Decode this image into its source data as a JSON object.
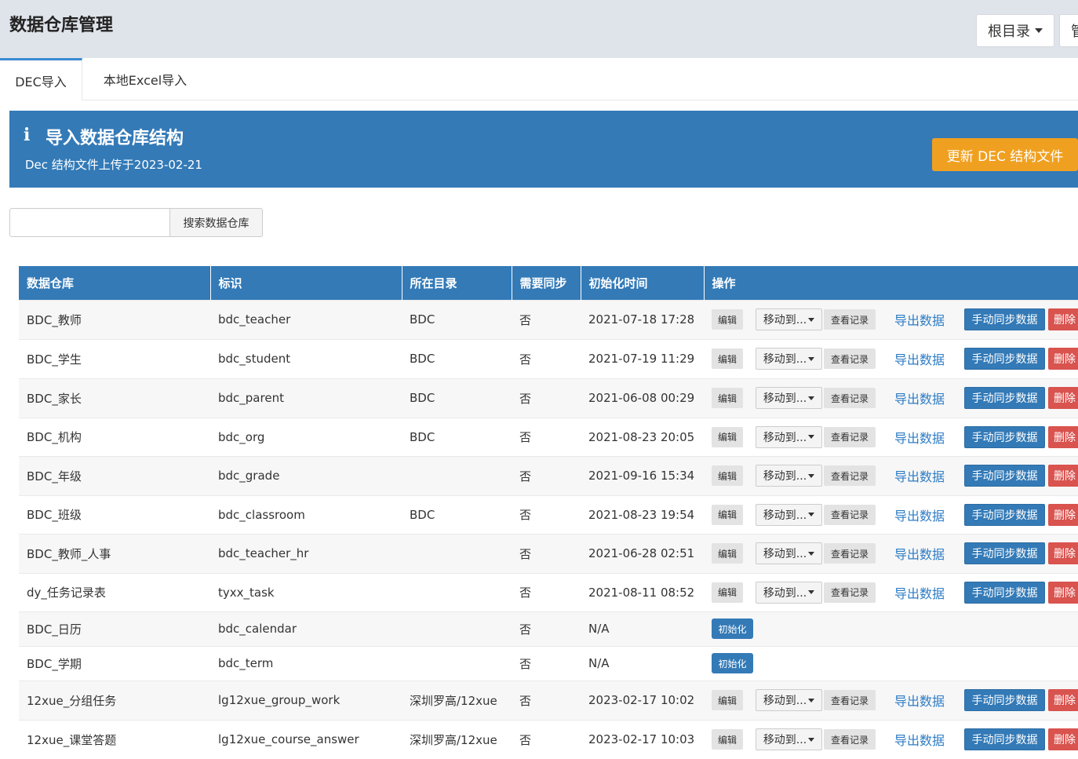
{
  "header": {
    "title": "数据仓库管理",
    "root_dir_label": "根目录",
    "manage_label": "管"
  },
  "tabs": [
    {
      "label": "DEC导入"
    },
    {
      "label": "本地Excel导入"
    }
  ],
  "banner": {
    "icon": "i",
    "title": "导入数据仓库结构",
    "subtitle": "Dec 结构文件上传于2023-02-21",
    "update_button": "更新 DEC 结构文件"
  },
  "search": {
    "value": "",
    "placeholder": "",
    "button": "搜索数据仓库"
  },
  "table": {
    "columns": [
      "数据仓库",
      "标识",
      "所在目录",
      "需要同步",
      "初始化时间",
      "操作"
    ],
    "action_labels": {
      "edit": "编辑",
      "move": "移动到...",
      "log": "查看记录",
      "export": "导出数据",
      "sync": "手动同步数据",
      "delete": "删除",
      "init": "初始化"
    },
    "rows": [
      {
        "name": "BDC_教师",
        "id": "bdc_teacher",
        "dir": "BDC",
        "sync": "否",
        "init_time": "2021-07-18 17:28",
        "initialized": true
      },
      {
        "name": "BDC_学生",
        "id": "bdc_student",
        "dir": "BDC",
        "sync": "否",
        "init_time": "2021-07-19 11:29",
        "initialized": true
      },
      {
        "name": "BDC_家长",
        "id": "bdc_parent",
        "dir": "BDC",
        "sync": "否",
        "init_time": "2021-06-08 00:29",
        "initialized": true
      },
      {
        "name": "BDC_机构",
        "id": "bdc_org",
        "dir": "BDC",
        "sync": "否",
        "init_time": "2021-08-23 20:05",
        "initialized": true
      },
      {
        "name": "BDC_年级",
        "id": "bdc_grade",
        "dir": "",
        "sync": "否",
        "init_time": "2021-09-16 15:34",
        "initialized": true
      },
      {
        "name": "BDC_班级",
        "id": "bdc_classroom",
        "dir": "BDC",
        "sync": "否",
        "init_time": "2021-08-23 19:54",
        "initialized": true
      },
      {
        "name": "BDC_教师_人事",
        "id": "bdc_teacher_hr",
        "dir": "",
        "sync": "否",
        "init_time": "2021-06-28 02:51",
        "initialized": true
      },
      {
        "name": "dy_任务记录表",
        "id": "tyxx_task",
        "dir": "",
        "sync": "否",
        "init_time": "2021-08-11 08:52",
        "initialized": true
      },
      {
        "name": "BDC_日历",
        "id": "bdc_calendar",
        "dir": "",
        "sync": "否",
        "init_time": "N/A",
        "initialized": false
      },
      {
        "name": "BDC_学期",
        "id": "bdc_term",
        "dir": "",
        "sync": "否",
        "init_time": "N/A",
        "initialized": false
      },
      {
        "name": "12xue_分组任务",
        "id": "lg12xue_group_work",
        "dir": "深圳罗高/12xue",
        "sync": "否",
        "init_time": "2023-02-17 10:02",
        "initialized": true
      },
      {
        "name": "12xue_课堂答题",
        "id": "lg12xue_course_answer",
        "dir": "深圳罗高/12xue",
        "sync": "否",
        "init_time": "2023-02-17 10:03",
        "initialized": true
      }
    ]
  }
}
